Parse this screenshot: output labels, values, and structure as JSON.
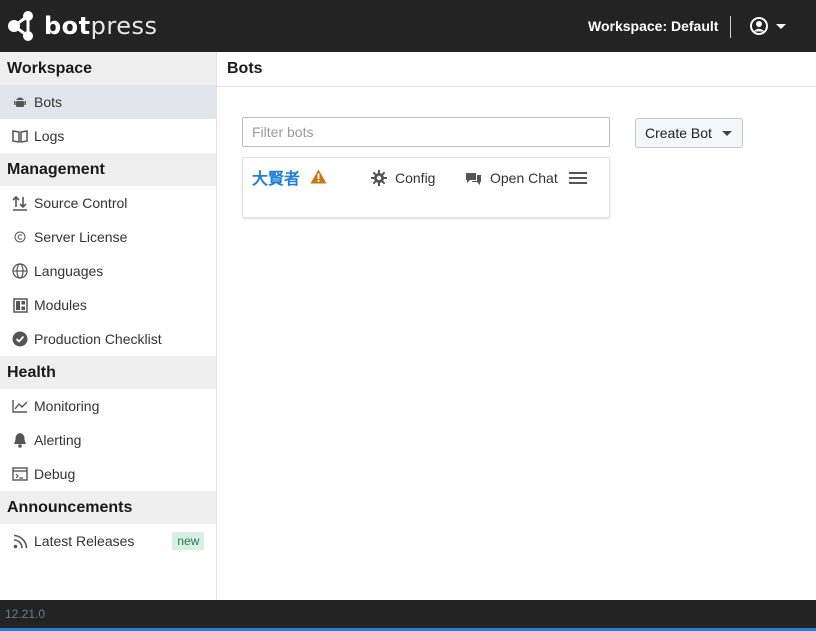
{
  "header": {
    "brand_bold": "bot",
    "brand_light": "press",
    "workspace_label": "Workspace: Default"
  },
  "sidebar": {
    "sections": [
      {
        "title": "Workspace"
      },
      {
        "title": "Management"
      },
      {
        "title": "Health"
      },
      {
        "title": "Announcements"
      }
    ],
    "items": [
      {
        "label": "Bots",
        "icon": "android-icon",
        "active": true
      },
      {
        "label": "Logs",
        "icon": "book-icon"
      },
      {
        "label": "Source Control",
        "icon": "sort-arrows-icon"
      },
      {
        "label": "Server License",
        "icon": "copyright-icon"
      },
      {
        "label": "Languages",
        "icon": "globe-icon"
      },
      {
        "label": "Modules",
        "icon": "modules-grid-icon"
      },
      {
        "label": "Production Checklist",
        "icon": "check-badge-icon"
      },
      {
        "label": "Monitoring",
        "icon": "timeline-chart-icon"
      },
      {
        "label": "Alerting",
        "icon": "bell-icon"
      },
      {
        "label": "Debug",
        "icon": "console-icon"
      },
      {
        "label": "Latest Releases",
        "icon": "rss-icon",
        "badge": "new"
      }
    ]
  },
  "main": {
    "title": "Bots",
    "filter_placeholder": "Filter bots",
    "create_button": "Create Bot",
    "bots": [
      {
        "name": "大賢者",
        "config_label": "Config",
        "chat_label": "Open Chat",
        "warning": true
      }
    ]
  },
  "footer": {
    "version": "12.21.0"
  },
  "colors": {
    "accent": "#1f7fd6",
    "topbar": "#232323",
    "warning": "#c87619"
  }
}
